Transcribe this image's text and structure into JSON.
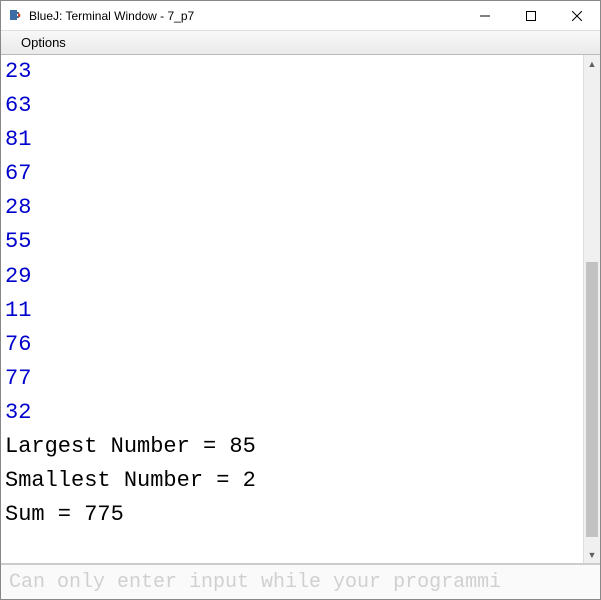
{
  "window": {
    "title": "BlueJ: Terminal Window - 7_p7"
  },
  "menu": {
    "options": "Options"
  },
  "terminal": {
    "user_lines": [
      "23",
      "63",
      "81",
      "67",
      "28",
      "55",
      "29",
      "11",
      "76",
      "77",
      "32"
    ],
    "system_lines": [
      "Largest Number = 85",
      "Smallest Number = 2",
      "Sum = 775"
    ]
  },
  "input": {
    "placeholder": "Can only enter input while your programmi"
  }
}
